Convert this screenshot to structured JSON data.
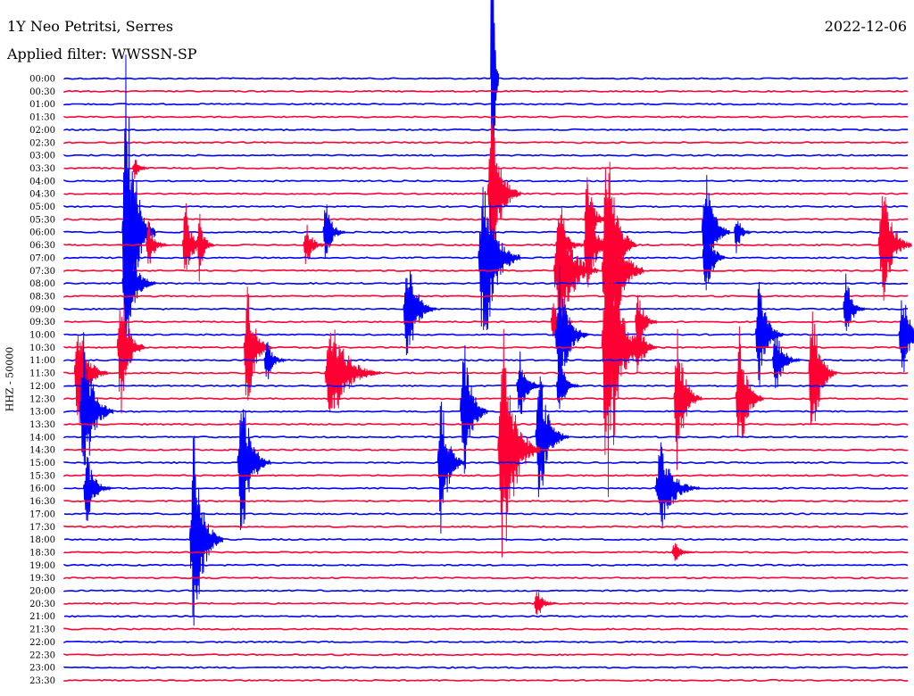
{
  "header": {
    "station": "1Y Neo Petritsi, Serres",
    "date": "2022-12-06",
    "filter": "Applied filter: WWSSN-SP"
  },
  "channel_label": "HHZ - 50000",
  "colors": {
    "odd": "#0000ff",
    "even": "#ff0033",
    "background": "#ffffff"
  },
  "chart_data": {
    "type": "line",
    "title": "1Y Neo Petritsi, Serres",
    "subtitle": "Applied filter: WWSSN-SP",
    "ylabel": "HHZ - 50000",
    "trace_labels": [
      "00:00",
      "00:30",
      "01:00",
      "01:30",
      "02:00",
      "02:30",
      "03:00",
      "03:30",
      "04:00",
      "04:30",
      "05:00",
      "05:30",
      "06:00",
      "06:30",
      "07:00",
      "07:30",
      "08:00",
      "08:30",
      "09:00",
      "09:30",
      "10:00",
      "10:30",
      "11:00",
      "11:30",
      "12:00",
      "12:30",
      "13:00",
      "13:30",
      "14:00",
      "14:30",
      "15:00",
      "15:30",
      "16:00",
      "16:30",
      "17:00",
      "17:30",
      "18:00",
      "18:30",
      "19:00",
      "19:30",
      "20:00",
      "20:30",
      "21:00",
      "21:30",
      "22:00",
      "22:30",
      "23:00",
      "23:30"
    ],
    "trace_minutes": 30,
    "events": [
      {
        "trace": "00:00",
        "minute": 15.2,
        "amplitude": 38,
        "duration": 0.3
      },
      {
        "trace": "03:30",
        "minute": 2.5,
        "amplitude": 2,
        "duration": 0.6
      },
      {
        "trace": "04:30",
        "minute": 15.2,
        "amplitude": 14,
        "duration": 1.2
      },
      {
        "trace": "05:30",
        "minute": 18.6,
        "amplitude": 8,
        "duration": 0.8
      },
      {
        "trace": "06:00",
        "minute": 2.2,
        "amplitude": 30,
        "duration": 1.2
      },
      {
        "trace": "06:00",
        "minute": 9.3,
        "amplitude": 6,
        "duration": 0.8
      },
      {
        "trace": "06:00",
        "minute": 22.8,
        "amplitude": 14,
        "duration": 1.0
      },
      {
        "trace": "06:00",
        "minute": 23.9,
        "amplitude": 4,
        "duration": 0.6
      },
      {
        "trace": "06:30",
        "minute": 3.0,
        "amplitude": 4,
        "duration": 0.8
      },
      {
        "trace": "06:30",
        "minute": 4.3,
        "amplitude": 8,
        "duration": 0.8
      },
      {
        "trace": "06:30",
        "minute": 4.8,
        "amplitude": 6,
        "duration": 0.6
      },
      {
        "trace": "06:30",
        "minute": 8.6,
        "amplitude": 4,
        "duration": 0.8
      },
      {
        "trace": "06:30",
        "minute": 17.6,
        "amplitude": 6,
        "duration": 1.0
      },
      {
        "trace": "06:30",
        "minute": 18.6,
        "amplitude": 10,
        "duration": 1.0
      },
      {
        "trace": "06:30",
        "minute": 19.3,
        "amplitude": 20,
        "duration": 1.2
      },
      {
        "trace": "06:30",
        "minute": 29.1,
        "amplitude": 12,
        "duration": 1.2
      },
      {
        "trace": "07:00",
        "minute": 14.9,
        "amplitude": 18,
        "duration": 1.5
      },
      {
        "trace": "07:00",
        "minute": 22.8,
        "amplitude": 10,
        "duration": 0.8
      },
      {
        "trace": "07:30",
        "minute": 17.6,
        "amplitude": 14,
        "duration": 1.6
      },
      {
        "trace": "07:30",
        "minute": 19.3,
        "amplitude": 20,
        "duration": 1.5
      },
      {
        "trace": "08:00",
        "minute": 2.2,
        "amplitude": 10,
        "duration": 1.2
      },
      {
        "trace": "09:00",
        "minute": 12.2,
        "amplitude": 10,
        "duration": 1.2
      },
      {
        "trace": "09:00",
        "minute": 27.8,
        "amplitude": 6,
        "duration": 0.8
      },
      {
        "trace": "09:30",
        "minute": 17.4,
        "amplitude": 4,
        "duration": 0.8
      },
      {
        "trace": "09:30",
        "minute": 20.4,
        "amplitude": 6,
        "duration": 0.8
      },
      {
        "trace": "10:00",
        "minute": 17.6,
        "amplitude": 12,
        "duration": 1.2
      },
      {
        "trace": "10:00",
        "minute": 24.7,
        "amplitude": 10,
        "duration": 1.0
      },
      {
        "trace": "10:00",
        "minute": 29.8,
        "amplitude": 8,
        "duration": 1.0
      },
      {
        "trace": "10:30",
        "minute": 2.0,
        "amplitude": 12,
        "duration": 1.0
      },
      {
        "trace": "10:30",
        "minute": 6.5,
        "amplitude": 12,
        "duration": 1.0
      },
      {
        "trace": "10:30",
        "minute": 19.3,
        "amplitude": 30,
        "duration": 1.5
      },
      {
        "trace": "10:30",
        "minute": 20.4,
        "amplitude": 6,
        "duration": 0.8
      },
      {
        "trace": "11:00",
        "minute": 7.2,
        "amplitude": 4,
        "duration": 0.8
      },
      {
        "trace": "11:00",
        "minute": 25.3,
        "amplitude": 6,
        "duration": 1.0
      },
      {
        "trace": "11:30",
        "minute": 0.5,
        "amplitude": 10,
        "duration": 1.2
      },
      {
        "trace": "11:30",
        "minute": 9.5,
        "amplitude": 10,
        "duration": 2.0
      },
      {
        "trace": "11:30",
        "minute": 26.6,
        "amplitude": 14,
        "duration": 1.0
      },
      {
        "trace": "12:00",
        "minute": 16.2,
        "amplitude": 6,
        "duration": 1.0
      },
      {
        "trace": "12:00",
        "minute": 17.6,
        "amplitude": 6,
        "duration": 0.8
      },
      {
        "trace": "12:30",
        "minute": 21.8,
        "amplitude": 12,
        "duration": 1.0
      },
      {
        "trace": "12:30",
        "minute": 24.0,
        "amplitude": 12,
        "duration": 1.0
      },
      {
        "trace": "13:00",
        "minute": 0.7,
        "amplitude": 14,
        "duration": 1.2
      },
      {
        "trace": "13:00",
        "minute": 14.2,
        "amplitude": 14,
        "duration": 1.0
      },
      {
        "trace": "14:00",
        "minute": 16.9,
        "amplitude": 12,
        "duration": 1.2
      },
      {
        "trace": "14:30",
        "minute": 15.6,
        "amplitude": 22,
        "duration": 1.5
      },
      {
        "trace": "15:00",
        "minute": 6.3,
        "amplitude": 14,
        "duration": 1.2
      },
      {
        "trace": "15:00",
        "minute": 13.4,
        "amplitude": 12,
        "duration": 1.0
      },
      {
        "trace": "16:00",
        "minute": 0.8,
        "amplitude": 6,
        "duration": 1.0
      },
      {
        "trace": "16:00",
        "minute": 21.2,
        "amplitude": 8,
        "duration": 1.6
      },
      {
        "trace": "18:00",
        "minute": 4.6,
        "amplitude": 18,
        "duration": 1.2
      },
      {
        "trace": "18:30",
        "minute": 21.7,
        "amplitude": 2,
        "duration": 0.8
      },
      {
        "trace": "20:30",
        "minute": 16.8,
        "amplitude": 3,
        "duration": 0.8
      }
    ]
  }
}
